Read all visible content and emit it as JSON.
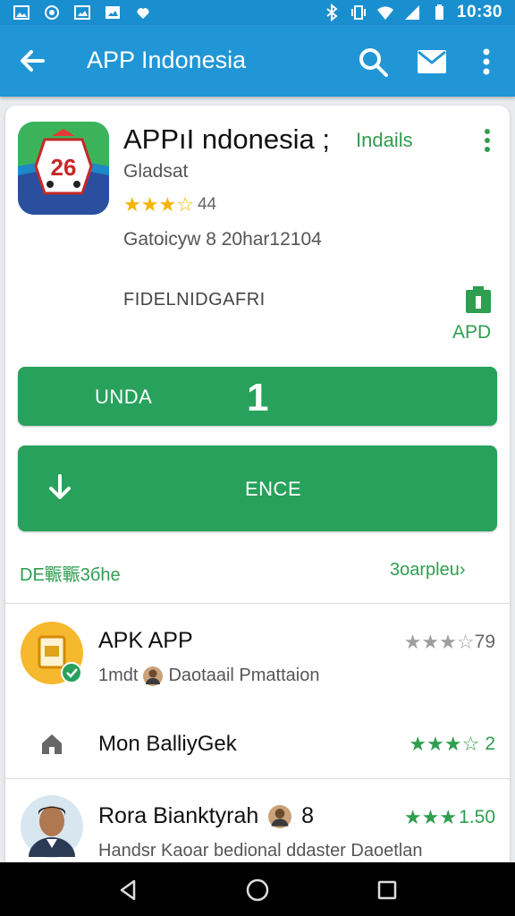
{
  "status_bar": {
    "time": "10:30",
    "icons": [
      "image-icon",
      "sync-icon",
      "gallery-icon",
      "photo-icon",
      "heart-icon",
      "bluetooth-icon",
      "vibrate-icon",
      "wifi-icon",
      "signal-icon",
      "battery-icon"
    ]
  },
  "app_bar": {
    "title": "APP Indonesia",
    "icons": [
      "back-arrow-icon",
      "search-icon",
      "mail-icon",
      "more-vert-icon"
    ]
  },
  "app": {
    "name": "APPıI ndonesia ;",
    "tag": "Indails",
    "developer": "Gladsat",
    "stars_filled": 3,
    "stars_total": 4,
    "rating_count": "44",
    "category": "Gatoicyw 8 20har12104",
    "icon_number": "26",
    "info_label": "FIDELNIDGAFRI",
    "apd_label": "APD"
  },
  "buttons": {
    "update_label": "UNDA",
    "update_badge": "1",
    "install_label": "ENCE"
  },
  "section": {
    "title": "DE辴辴3бhe",
    "more": "3oarpleu›"
  },
  "list": [
    {
      "title": "APK APP",
      "subtitle_prefix": "1mdt",
      "subtitle": "Daotaail Pmattaion",
      "rating_filled": 3,
      "rating_total": 4,
      "rating_text": "79",
      "star_color": "#9e9e9e"
    },
    {
      "title": "Mon BalliyGek",
      "subtitle_prefix": "",
      "subtitle": "",
      "rating_filled": 3,
      "rating_total": 4,
      "rating_text": "2",
      "star_color": "#2e9e4f"
    },
    {
      "title": "Rora Bianktyrah",
      "title_suffix": "8",
      "subtitle_prefix": "",
      "subtitle": "Handsr Kaoar bedional ddaster Daoetlan",
      "rating_filled": 3,
      "rating_total": 3,
      "rating_text": "1.50",
      "star_color": "#2e9e4f"
    }
  ],
  "colors": {
    "status_bar": "#1a8fd0",
    "app_bar": "#2196d6",
    "accent_green": "#27a15b",
    "star_yellow": "#f4b400"
  }
}
